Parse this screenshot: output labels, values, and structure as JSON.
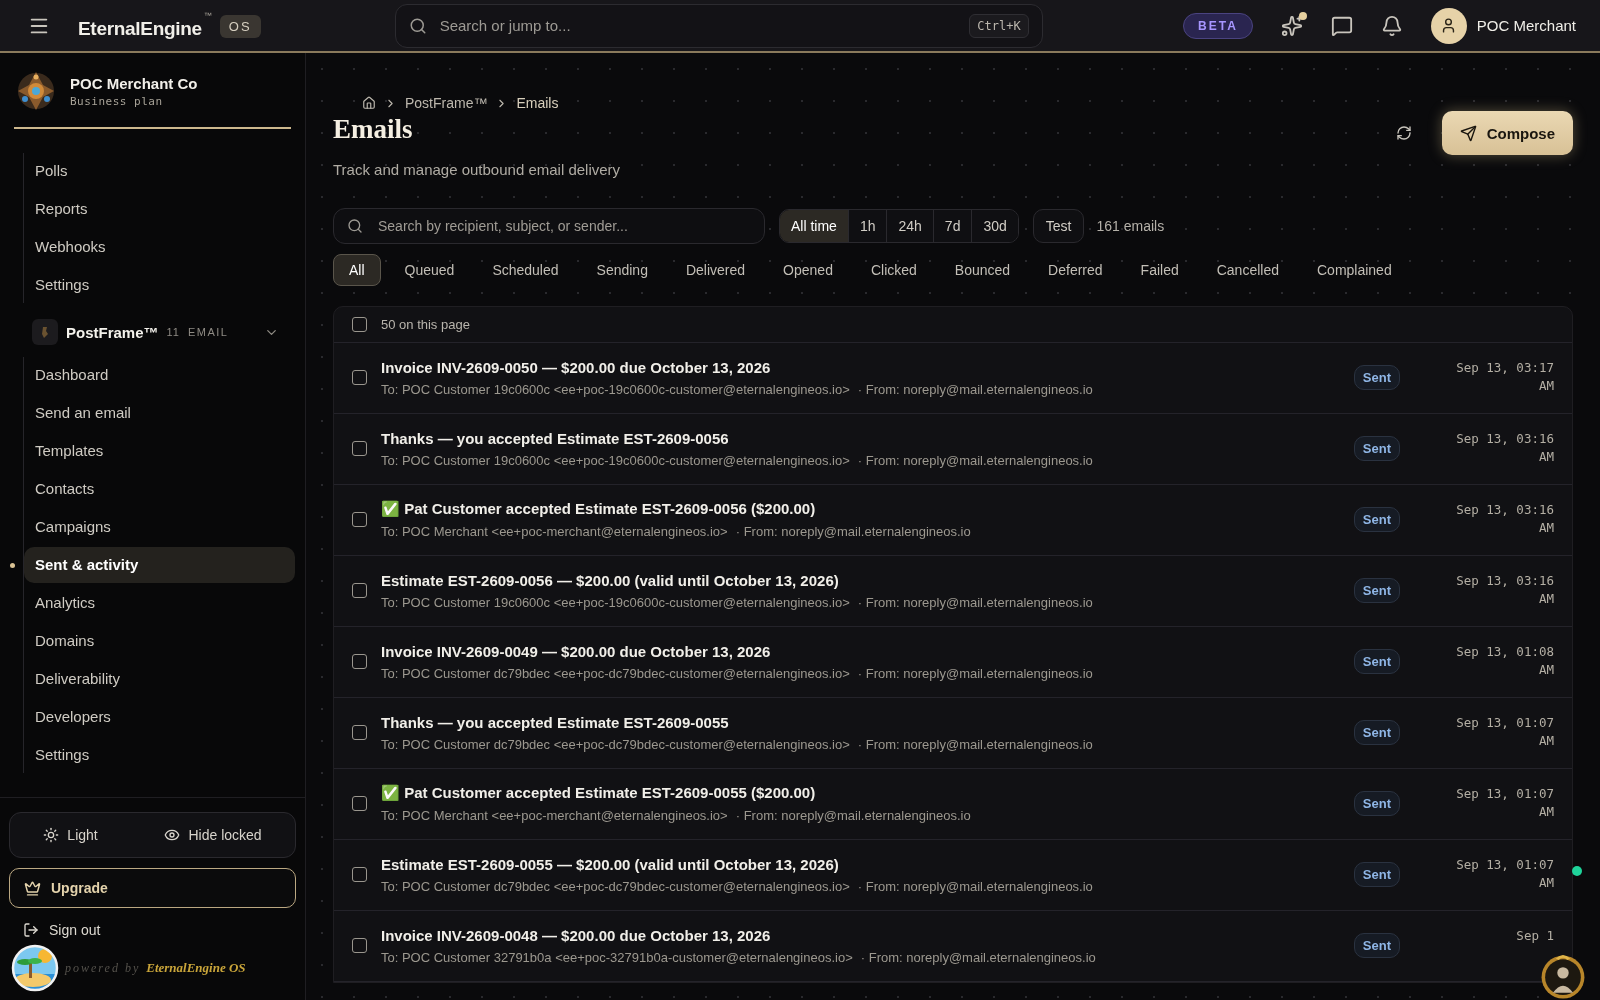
{
  "topbar": {
    "brand": "EternalEngine",
    "brand_mark": "™",
    "brand_badge": "OS",
    "search": {
      "placeholder": "Search or jump to..."
    },
    "shortcut": "Ctrl+K",
    "beta": "BETA",
    "user": "POC Merchant"
  },
  "sidebar": {
    "org": {
      "name": "POC Merchant Co",
      "plan": "Business plan"
    },
    "items_above": [
      {
        "label": "Polls",
        "selected": false
      },
      {
        "label": "Reports",
        "selected": false
      },
      {
        "label": "Webhooks",
        "selected": false
      },
      {
        "label": "Settings",
        "selected": false
      }
    ],
    "section": {
      "name": "PostFrame™",
      "count": "11",
      "tag": "EMAIL",
      "expanded": true,
      "items": [
        {
          "label": "Dashboard",
          "selected": false
        },
        {
          "label": "Send an email",
          "selected": false
        },
        {
          "label": "Templates",
          "selected": false
        },
        {
          "label": "Contacts",
          "selected": false
        },
        {
          "label": "Campaigns",
          "selected": false
        },
        {
          "label": "Sent & activity",
          "selected": true
        },
        {
          "label": "Analytics",
          "selected": false
        },
        {
          "label": "Domains",
          "selected": false
        },
        {
          "label": "Deliverability",
          "selected": false
        },
        {
          "label": "Developers",
          "selected": false
        },
        {
          "label": "Settings",
          "selected": false
        }
      ]
    },
    "footer": {
      "theme": "Light",
      "hide_locked": "Hide locked",
      "upgrade": "Upgrade",
      "sign_out": "Sign out",
      "powered_by": "powered by",
      "powered_brand": "EternalEngine OS"
    }
  },
  "breadcrumb": [
    "PostFrame™",
    "Emails"
  ],
  "page": {
    "title": "Emails",
    "subtitle": "Track and manage outbound email delivery",
    "compose": "Compose"
  },
  "search": {
    "placeholder": "Search by recipient, subject, or sender..."
  },
  "time_ranges": [
    {
      "label": "All time",
      "selected": true
    },
    {
      "label": "1h",
      "selected": false
    },
    {
      "label": "24h",
      "selected": false
    },
    {
      "label": "7d",
      "selected": false
    },
    {
      "label": "30d",
      "selected": false
    }
  ],
  "test": {
    "label": "Test",
    "selected": false
  },
  "count": "161 emails",
  "status_filters": [
    {
      "label": "All",
      "selected": true
    },
    {
      "label": "Queued",
      "selected": false
    },
    {
      "label": "Scheduled",
      "selected": false
    },
    {
      "label": "Sending",
      "selected": false
    },
    {
      "label": "Delivered",
      "selected": false
    },
    {
      "label": "Opened",
      "selected": false
    },
    {
      "label": "Clicked",
      "selected": false
    },
    {
      "label": "Bounced",
      "selected": false
    },
    {
      "label": "Deferred",
      "selected": false
    },
    {
      "label": "Failed",
      "selected": false
    },
    {
      "label": "Cancelled",
      "selected": false
    },
    {
      "label": "Complained",
      "selected": false
    }
  ],
  "table": {
    "select_all": {
      "label": "50 on this page",
      "checked": false
    },
    "rows": [
      {
        "title": "Invoice INV-2609-0050 — $200.00 due October 13, 2026",
        "to": "To: POC Customer 19c0600c <ee+poc-19c0600c-customer@eternalengineos.io>",
        "from": "· From: noreply@mail.eternalengineos.io",
        "status": "Sent",
        "time": "Sep 13, 03:17 AM",
        "checked": false
      },
      {
        "title": "Thanks — you accepted Estimate EST-2609-0056",
        "to": "To: POC Customer 19c0600c <ee+poc-19c0600c-customer@eternalengineos.io>",
        "from": "· From: noreply@mail.eternalengineos.io",
        "status": "Sent",
        "time": "Sep 13, 03:16 AM",
        "checked": false
      },
      {
        "title": "✅ Pat Customer accepted Estimate EST-2609-0056 ($200.00)",
        "to": "To: POC Merchant <ee+poc-merchant@eternalengineos.io>",
        "from": "· From: noreply@mail.eternalengineos.io",
        "status": "Sent",
        "time": "Sep 13, 03:16 AM",
        "checked": false
      },
      {
        "title": "Estimate EST-2609-0056 — $200.00 (valid until October 13, 2026)",
        "to": "To: POC Customer 19c0600c <ee+poc-19c0600c-customer@eternalengineos.io>",
        "from": "· From: noreply@mail.eternalengineos.io",
        "status": "Sent",
        "time": "Sep 13, 03:16 AM",
        "checked": false
      },
      {
        "title": "Invoice INV-2609-0049 — $200.00 due October 13, 2026",
        "to": "To: POC Customer dc79bdec <ee+poc-dc79bdec-customer@eternalengineos.io>",
        "from": "· From: noreply@mail.eternalengineos.io",
        "status": "Sent",
        "time": "Sep 13, 01:08 AM",
        "checked": false
      },
      {
        "title": "Thanks — you accepted Estimate EST-2609-0055",
        "to": "To: POC Customer dc79bdec <ee+poc-dc79bdec-customer@eternalengineos.io>",
        "from": "· From: noreply@mail.eternalengineos.io",
        "status": "Sent",
        "time": "Sep 13, 01:07 AM",
        "checked": false
      },
      {
        "title": "✅ Pat Customer accepted Estimate EST-2609-0055 ($200.00)",
        "to": "To: POC Merchant <ee+poc-merchant@eternalengineos.io>",
        "from": "· From: noreply@mail.eternalengineos.io",
        "status": "Sent",
        "time": "Sep 13, 01:07 AM",
        "checked": false
      },
      {
        "title": "Estimate EST-2609-0055 — $200.00 (valid until October 13, 2026)",
        "to": "To: POC Customer dc79bdec <ee+poc-dc79bdec-customer@eternalengineos.io>",
        "from": "· From: noreply@mail.eternalengineos.io",
        "status": "Sent",
        "time": "Sep 13, 01:07 AM",
        "checked": false
      },
      {
        "title": "Invoice INV-2609-0048 — $200.00 due October 13, 2026",
        "to": "To: POC Customer 32791b0a <ee+poc-32791b0a-customer@eternalengineos.io>",
        "from": "· From: noreply@mail.eternalengineos.io",
        "status": "Sent",
        "time": "Sep 1",
        "checked": false
      }
    ]
  },
  "assistant": {
    "online": true
  }
}
